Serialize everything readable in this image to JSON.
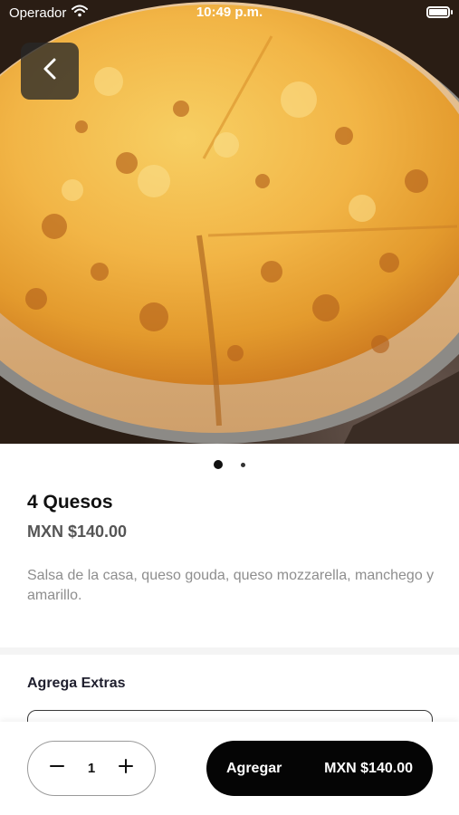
{
  "status_bar": {
    "carrier": "Operador",
    "time": "10:49 p.m."
  },
  "hero": {
    "image": "pizza-image",
    "page_indicator": {
      "pages": 2,
      "active": 1
    }
  },
  "product": {
    "name": "4 Quesos",
    "price": "MXN $140.00",
    "description": "Salsa de la casa, queso gouda, queso mozzarella, manchego y amarillo."
  },
  "extras": {
    "title": "Agrega Extras"
  },
  "bottom_bar": {
    "quantity": "1",
    "add_label": "Agregar",
    "add_price": "MXN $140.00"
  },
  "colors": {
    "button": "#050505",
    "muted_text": "#8e8e8e",
    "price_text": "#555555"
  }
}
